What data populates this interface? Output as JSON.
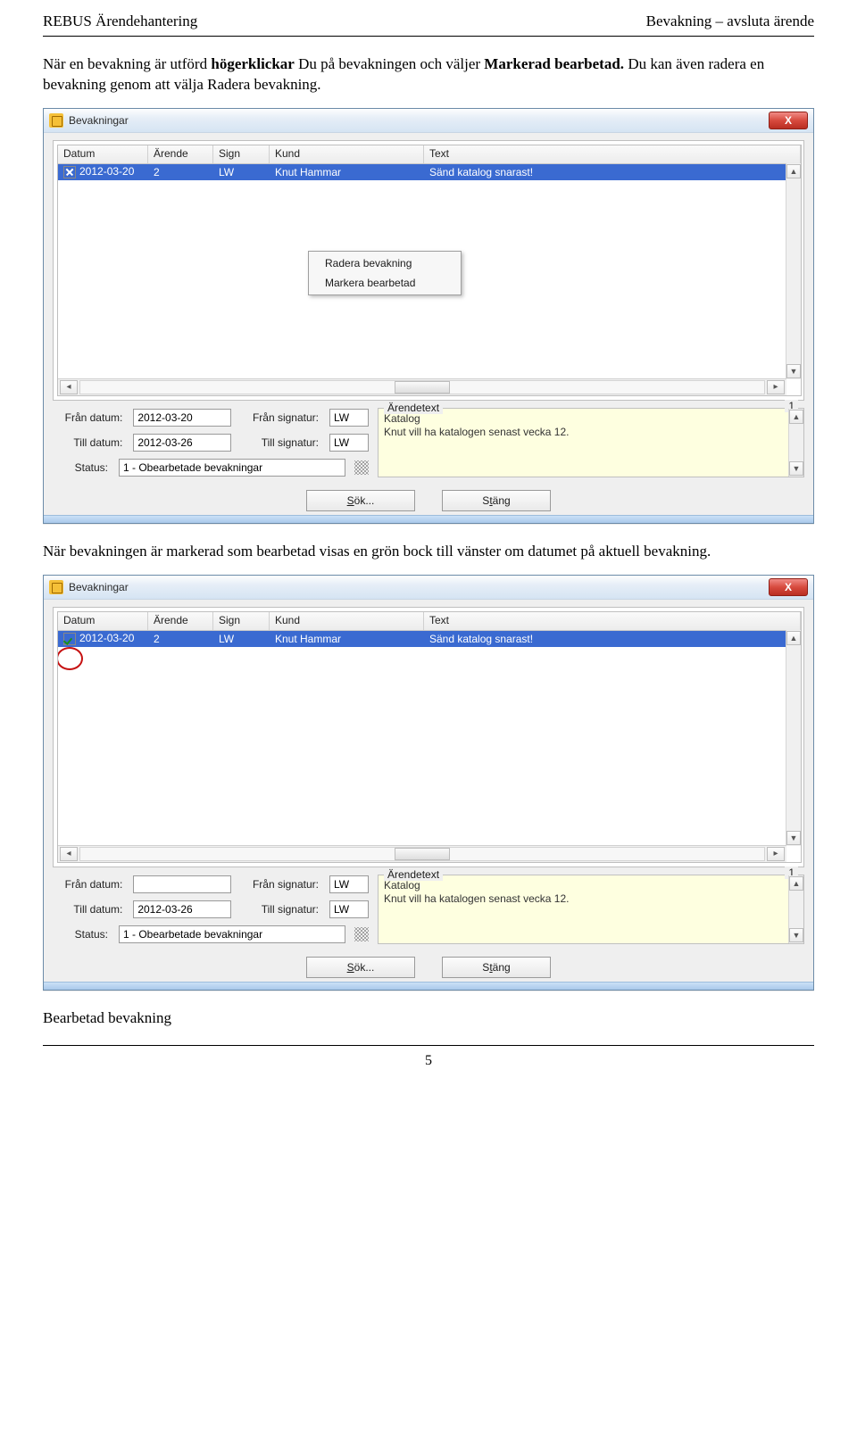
{
  "header": {
    "left": "REBUS Ärendehantering",
    "right": "Bevakning – avsluta ärende"
  },
  "paragraph1": {
    "pre": "När en bevakning är utförd ",
    "bold1": "högerklickar",
    "mid": " Du på bevakningen och väljer ",
    "bold2": "Markerad bearbetad.",
    "post": " Du kan även radera en bevakning genom att välja Radera bevakning."
  },
  "paragraph2": "När bevakningen är markerad som bearbetad visas en grön bock till vänster om datumet på aktuell bevakning.",
  "caption": "Bearbetad bevakning",
  "page_number": "5",
  "window": {
    "title": "Bevakningar",
    "close": "X"
  },
  "columns": {
    "datum": "Datum",
    "arende": "Ärende",
    "sign": "Sign",
    "kund": "Kund",
    "text": "Text"
  },
  "row1": {
    "datum": "2012-03-20",
    "arende": "2",
    "sign": "LW",
    "kund": "Knut Hammar",
    "text": "Sänd katalog snarast!"
  },
  "context_menu": {
    "item1": "Radera bevakning",
    "item2": "Markera bearbetad"
  },
  "filters": {
    "fran_datum_lbl": "Från datum:",
    "till_datum_lbl": "Till datum:",
    "fran_sign_lbl": "Från signatur:",
    "till_sign_lbl": "Till signatur:",
    "status_lbl": "Status:",
    "fran_datum_val": "2012-03-20",
    "till_datum_val": "2012-03-26",
    "fran_sign_val": "LW",
    "till_sign_val": "LW",
    "status_val": "1 - Obearbetade bevakningar"
  },
  "fieldset": {
    "label": "Ärendetext",
    "badge": "1",
    "line1": "Katalog",
    "line2": "Knut vill ha katalogen senast vecka 12."
  },
  "buttons": {
    "sok_u": "S",
    "sok_rest": "ök...",
    "stang_pre": "S",
    "stang_u": "t",
    "stang_rest": "äng"
  },
  "filters2": {
    "fran_datum_val": "",
    "till_datum_val": "2012-03-26",
    "fran_sign_val": "LW",
    "till_sign_val": "LW",
    "status_val": "1 - Obearbetade bevakningar"
  }
}
